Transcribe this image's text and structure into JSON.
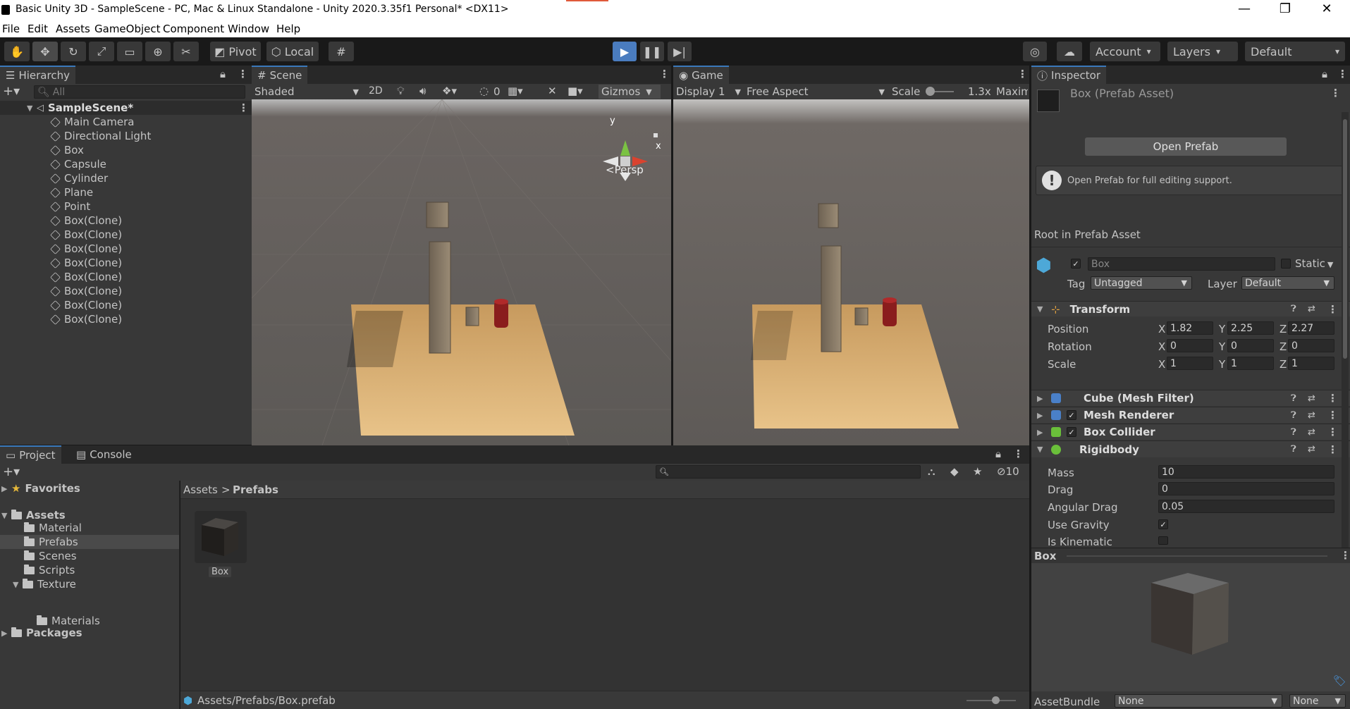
{
  "window": {
    "title": "Basic Unity 3D - SampleScene - PC, Mac & Linux Standalone - Unity 2020.3.35f1 Personal* <DX11>"
  },
  "menu": [
    "File",
    "Edit",
    "Assets",
    "GameObject",
    "Component",
    "Window",
    "Help"
  ],
  "toolbar": {
    "pivot": "Pivot",
    "local": "Local",
    "account": "Account",
    "layers": "Layers",
    "layout": "Default"
  },
  "hierarchy": {
    "tab": "Hierarchy",
    "search_placeholder": "All",
    "scene": "SampleScene*",
    "objects": [
      "Main Camera",
      "Directional Light",
      "Box",
      "Capsule",
      "Cylinder",
      "Plane",
      "Point",
      "Box(Clone)",
      "Box(Clone)",
      "Box(Clone)",
      "Box(Clone)",
      "Box(Clone)",
      "Box(Clone)",
      "Box(Clone)",
      "Box(Clone)"
    ]
  },
  "scene_view": {
    "tab": "Scene",
    "shading": "Shaded",
    "mode2d": "2D",
    "hidden_count": "0",
    "gizmos": "Gizmos",
    "persp": "Persp",
    "axis_y": "y",
    "axis_x": "x"
  },
  "game_view": {
    "tab": "Game",
    "display": "Display 1",
    "aspect": "Free Aspect",
    "scale_label": "Scale",
    "scale_value": "1.3x",
    "maximize": "Maxim"
  },
  "inspector": {
    "tab": "Inspector",
    "asset_name": "Box (Prefab Asset)",
    "open_prefab": "Open Prefab",
    "info": "Open Prefab for full editing support.",
    "root_label": "Root in Prefab Asset",
    "object_name": "Box",
    "static_label": "Static",
    "tag_label": "Tag",
    "tag_value": "Untagged",
    "layer_label": "Layer",
    "layer_value": "Default",
    "transform": {
      "title": "Transform",
      "position": {
        "label": "Position",
        "x": "1.82",
        "y": "2.25",
        "z": "2.27"
      },
      "rotation": {
        "label": "Rotation",
        "x": "0",
        "y": "0",
        "z": "0"
      },
      "scale": {
        "label": "Scale",
        "x": "1",
        "y": "1",
        "z": "1"
      }
    },
    "components": [
      "Cube (Mesh Filter)",
      "Mesh Renderer",
      "Box Collider"
    ],
    "rigidbody": {
      "title": "Rigidbody",
      "mass_label": "Mass",
      "mass": "10",
      "drag_label": "Drag",
      "drag": "0",
      "angular_drag_label": "Angular Drag",
      "angular_drag": "0.05",
      "use_gravity_label": "Use Gravity",
      "use_gravity": true,
      "is_kinematic_label": "Is Kinematic",
      "is_kinematic": false
    },
    "preview_label": "Box",
    "assetbundle_label": "AssetBundle",
    "assetbundle_value": "None",
    "assetbundle_variant": "None"
  },
  "project": {
    "tab_project": "Project",
    "tab_console": "Console",
    "hidden_count": "10",
    "favorites": "Favorites",
    "assets_root": "Assets",
    "folders": [
      "Material",
      "Prefabs",
      "Scenes",
      "Scripts",
      "Texture"
    ],
    "subfolder": "Materials",
    "packages": "Packages",
    "breadcrumb": [
      "Assets",
      "Prefabs"
    ],
    "item": "Box",
    "footer_path": "Assets/Prefabs/Box.prefab"
  },
  "colors": {
    "accent": "#3a79bb",
    "play_active": "#4a7cbf",
    "panel": "#383838",
    "dark": "#282828"
  }
}
